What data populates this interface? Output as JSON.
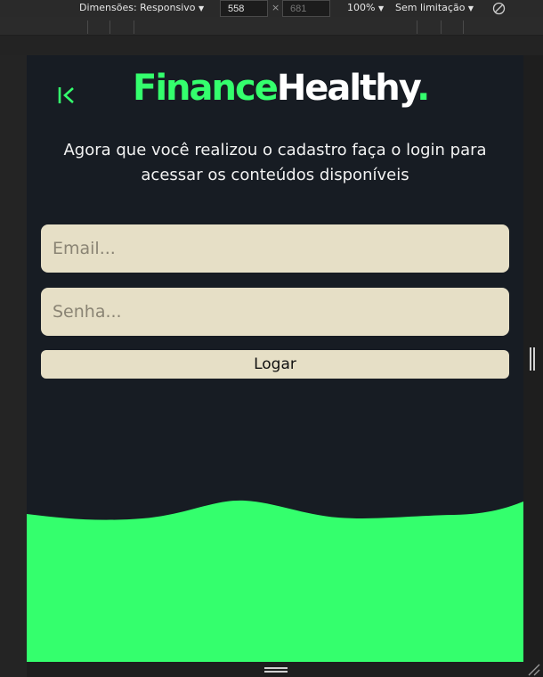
{
  "devtools": {
    "dimensions_label": "Dimensões: Responsivo",
    "width_value": "558",
    "times_symbol": "×",
    "height_placeholder": "681",
    "zoom_label": "100%",
    "throttle_label": "Sem limitação",
    "caret": "▼"
  },
  "app": {
    "logo_part1": "Finance",
    "logo_part2": "Healthy",
    "logo_dot": ".",
    "subtitle_line1": "Agora que você realizou o cadastro faça o login para",
    "subtitle_line2": "acessar os conteúdos disponíveis",
    "email_placeholder": "Email...",
    "password_placeholder": "Senha...",
    "login_button": "Logar"
  },
  "colors": {
    "brand_green": "#34ff6d",
    "background": "#171c23",
    "field_beige": "#e6dfc6"
  },
  "icons": [
    "back-icon",
    "rotate-icon",
    "resize-handle-icon"
  ]
}
